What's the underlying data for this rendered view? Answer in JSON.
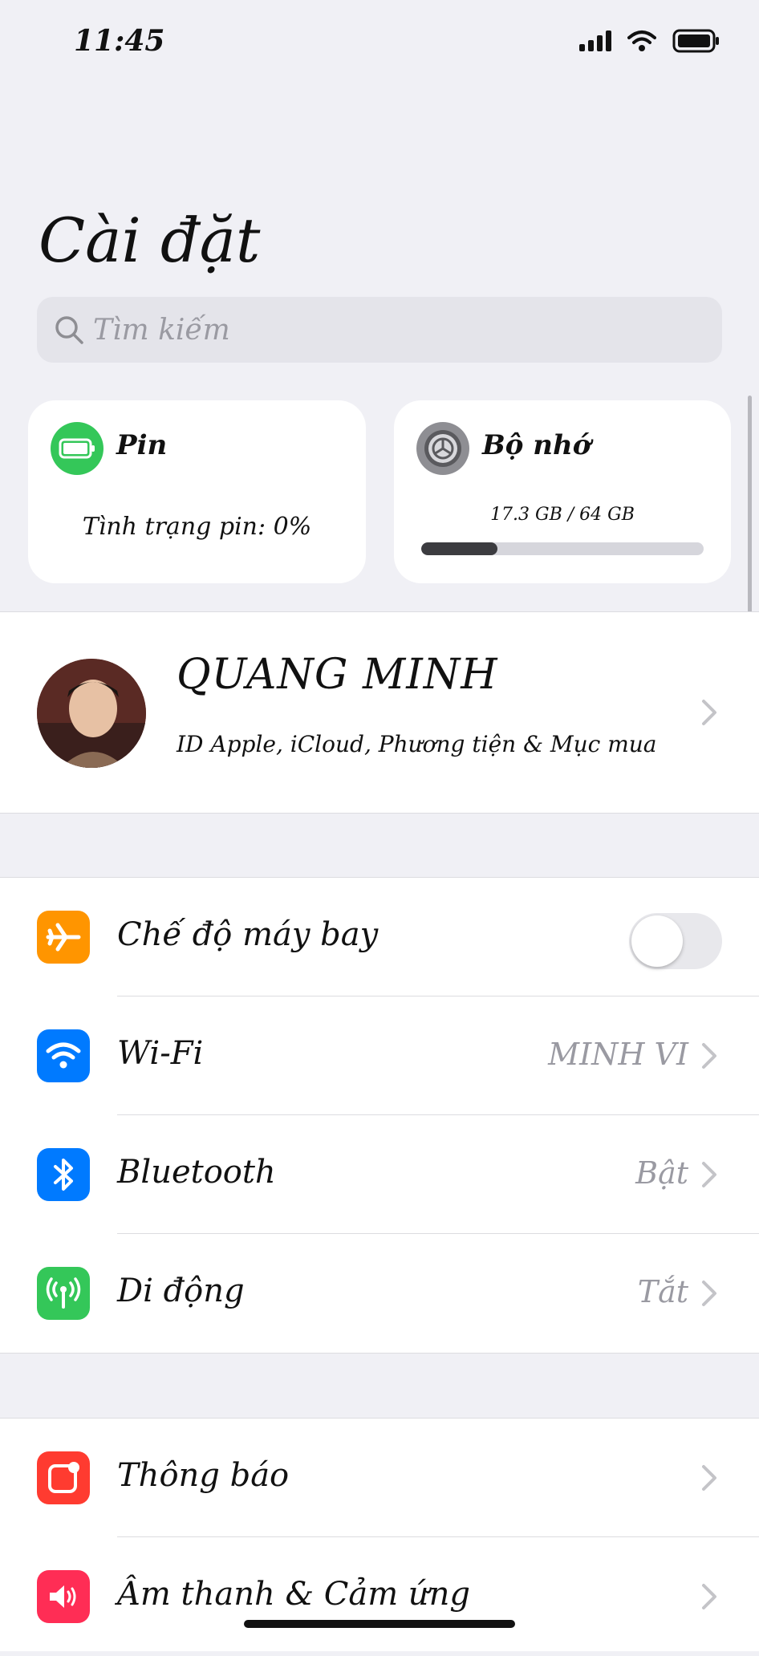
{
  "status_bar": {
    "time": "11:45"
  },
  "header": {
    "title": "Cài đặt"
  },
  "search": {
    "placeholder": "Tìm kiếm"
  },
  "cards": {
    "battery": {
      "title": "Pin",
      "status": "Tình trạng pin: 0%",
      "icon": "battery-icon",
      "color": "#34c759"
    },
    "storage": {
      "title": "Bộ nhớ",
      "usage": "17.3 GB / 64 GB",
      "used_fraction": 0.27,
      "icon": "gear-icon",
      "color": "#8e8e93"
    }
  },
  "profile": {
    "name": "QUANG MINH",
    "subtitle": "ID Apple, iCloud, Phương tiện & Mục mua"
  },
  "connectivity": {
    "airplane": {
      "label": "Chế độ máy bay",
      "toggle_on": false,
      "icon": "airplane-icon",
      "color": "#ff9500"
    },
    "wifi": {
      "label": "Wi-Fi",
      "value": "MINH VI",
      "icon": "wifi-icon",
      "color": "#007aff"
    },
    "bluetooth": {
      "label": "Bluetooth",
      "value": "Bật",
      "icon": "bluetooth-icon",
      "color": "#007aff"
    },
    "cellular": {
      "label": "Di động",
      "value": "Tắt",
      "icon": "cellular-icon",
      "color": "#34c759"
    }
  },
  "general": {
    "notifications": {
      "label": "Thông báo",
      "icon": "notifications-icon",
      "color": "#ff3b30"
    },
    "sounds": {
      "label": "Âm thanh & Cảm ứng",
      "icon": "speaker-icon",
      "color": "#ff2d55"
    }
  }
}
